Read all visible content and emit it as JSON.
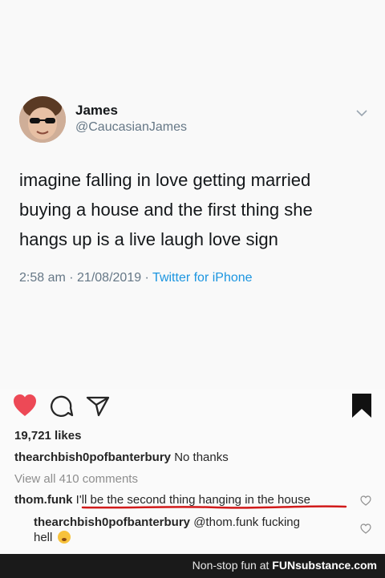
{
  "tweet": {
    "name": "James",
    "handle": "@CaucasianJames",
    "text_lines": [
      "imagine falling in love getting married",
      "buying a house and the first thing she",
      "hangs up is a live laugh love sign"
    ],
    "timestamp": "2:58 am · 21/08/2019 ·",
    "source": "Twitter for iPhone"
  },
  "post": {
    "likes": "19,721 likes",
    "caption": {
      "user": "thearchbish0pofbanterbury",
      "text": "No thanks"
    },
    "view_comments": "View all 410 comments",
    "comments": [
      {
        "user": "thom.funk",
        "text": "I'll be the second thing hanging in the house"
      },
      {
        "user": "thearchbish0pofbanterbury",
        "mention": "@thom.funk",
        "text_1": "fucking",
        "text_2": "hell"
      }
    ]
  },
  "footer": {
    "label": "Non-stop fun at",
    "brand": "FUNsubstance.com"
  },
  "colors": {
    "like": "#ed4956",
    "link": "#1b95e0",
    "underline": "#d11a1a"
  },
  "icons": [
    "avatar",
    "chevron-down-icon",
    "heart-icon",
    "comment-icon",
    "share-icon",
    "bookmark-icon",
    "small-heart-icon",
    "flushed-emoji-icon"
  ]
}
